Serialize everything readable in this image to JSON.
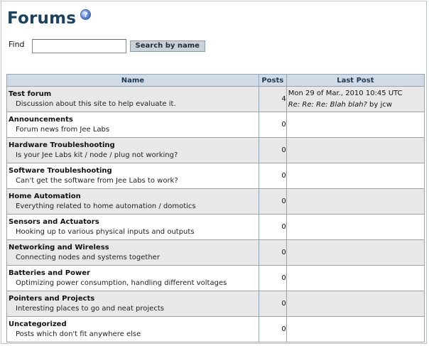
{
  "page": {
    "title": "Forums",
    "help_glyph": "?"
  },
  "search": {
    "label": "Find",
    "value": "",
    "placeholder": "",
    "button_label": "Search by name"
  },
  "table": {
    "headers": {
      "name": "Name",
      "posts": "Posts",
      "last_post": "Last Post"
    },
    "rows": [
      {
        "name": "Test forum",
        "description": "Discussion about this site to help evaluate it.",
        "posts": "4",
        "last_post": {
          "date": "Mon 29 of Mar., 2010 10:45 UTC",
          "subject": "Re: Re: Re: Blah blah?",
          "by": " by jcw"
        }
      },
      {
        "name": "Announcements",
        "description": "Forum news from Jee Labs",
        "posts": "0"
      },
      {
        "name": "Hardware Troubleshooting",
        "description": "Is your Jee Labs kit / node / plug not working?",
        "posts": "0"
      },
      {
        "name": "Software Troubleshooting",
        "description": "Can't get the software from Jee Labs to work?",
        "posts": "0"
      },
      {
        "name": "Home Automation",
        "description": "Everything related to home automation / domotics",
        "posts": "0"
      },
      {
        "name": "Sensors and Actuators",
        "description": "Hooking up to various physical inputs and outputs",
        "posts": "0"
      },
      {
        "name": "Networking and Wireless",
        "description": "Connecting nodes and systems together",
        "posts": "0"
      },
      {
        "name": "Batteries and Power",
        "description": "Optimizing power consumption, handling different voltages",
        "posts": "0"
      },
      {
        "name": "Pointers and Projects",
        "description": "Interesting places to go and neat projects",
        "posts": "0"
      },
      {
        "name": "Uncategorized",
        "description": "Posts which don't fit anywhere else",
        "posts": "0"
      }
    ]
  },
  "colors": {
    "title": "#1c4261",
    "header_bg": "#d0dbe5",
    "row_alt_bg": "#e8e8e8",
    "border": "#8fa6b9"
  },
  "icons": {
    "help": "help-icon"
  }
}
